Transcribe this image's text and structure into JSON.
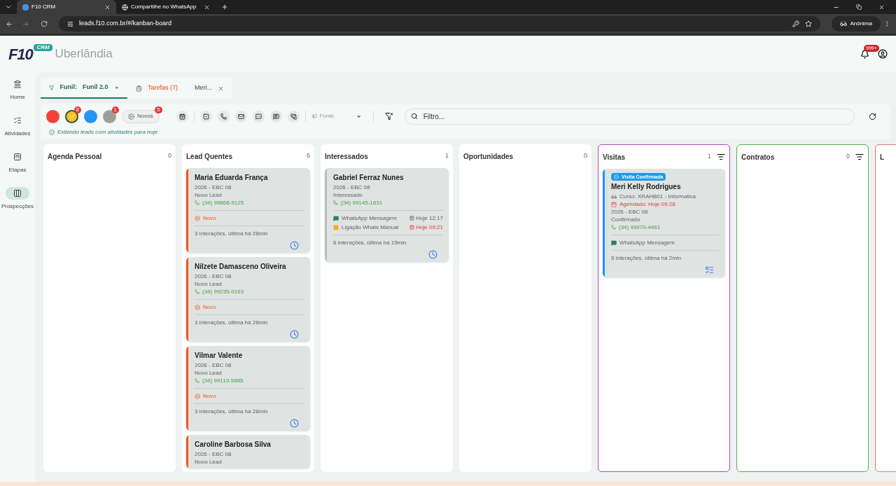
{
  "browser": {
    "tabs": [
      {
        "title": "F10 CRM",
        "selected": true
      },
      {
        "title": "Compartilhe no WhatsApp",
        "selected": false
      }
    ],
    "url": "leads.f10.com.br/#/kanban-board",
    "profile": "Anônima"
  },
  "header": {
    "logo": "F10",
    "logo_tag": "CRM",
    "city": "Uberlândia",
    "notifications": "999+"
  },
  "sidebar": {
    "items": [
      {
        "label": "Home",
        "selected": false
      },
      {
        "label": "Atividades",
        "selected": false
      },
      {
        "label": "Etapas",
        "selected": false
      },
      {
        "label": "Prospecções",
        "selected": true
      }
    ]
  },
  "tabs": [
    {
      "kind": "funnel",
      "label": "Funil:",
      "value": "Funil 2.0",
      "selected": true
    },
    {
      "kind": "tasks",
      "label": "Tarefas (7)",
      "selected": false
    },
    {
      "kind": "closable",
      "label": "Meri...",
      "selected": false
    }
  ],
  "toolbar": {
    "color_filters": [
      {
        "color": "#f44336",
        "checked": false
      },
      {
        "color": "#fbc02d",
        "checked": true,
        "badge": "8"
      },
      {
        "color": "#2196f3",
        "checked": false
      },
      {
        "color": "#9e9e9e",
        "checked": false,
        "badge": "1"
      }
    ],
    "new_button": {
      "label": "Novos",
      "badge": "5"
    },
    "source": {
      "placeholder": "Fonte"
    },
    "search": {
      "placeholder": "Filtro..."
    },
    "info": "Exibindo leads com atividades para hoje"
  },
  "columns": [
    {
      "title": "Agenda Pessoal",
      "count": "0"
    },
    {
      "title": "Lead Quentes",
      "count": "6",
      "cards": [
        {
          "kind": "pending",
          "name": "Maria Eduarda França",
          "group": "2026 - EBC 08",
          "stage": "Novo Lead",
          "phone": "(34) 99868-9125",
          "status": "Novo",
          "interactions": "3 interações, última há 28min",
          "color": "#f4511e"
        },
        {
          "kind": "pending",
          "name": "Nilzete Damasceno Oliveira",
          "group": "2026 - EBC 08",
          "stage": "Novo Lead",
          "phone": "(34) 99235-0163",
          "status": "Novo",
          "interactions": "3 interações, última há 28min",
          "color": "#f4511e"
        },
        {
          "kind": "pending",
          "name": "Vilmar Valente",
          "group": "2026 - EBC 08",
          "stage": "Novo Lead",
          "phone": "(34) 99119-5885",
          "status": "Novo",
          "interactions": "3 interações, última há 28min",
          "color": "#f4511e"
        },
        {
          "name": "Caroline Barbosa Silva",
          "group": "2026 - EBC 08",
          "stage": "Novo Lead",
          "color": "#f4511e"
        }
      ]
    },
    {
      "title": "Interessados",
      "count": "1",
      "cards": [
        {
          "kind": "pending",
          "name": "Gabriel Ferraz Nunes",
          "group": "2026 - EBC 08",
          "stage": "Interessado",
          "phone": "(34) 99145-1831",
          "activities": [
            {
              "kind": "whatsapp",
              "label": "WhatsApp Mensagem",
              "time": "Hoje 12:17",
              "overdue": false
            },
            {
              "kind": "call",
              "label": "Ligação Whats Manual",
              "time": "Hoje 09:21",
              "overdue": true
            }
          ],
          "interactions": "6 interações, última há 15min",
          "color": "#bdbdbd"
        }
      ]
    },
    {
      "title": "Oportunidades",
      "count": "0"
    },
    {
      "title": "Visitas",
      "count": "1",
      "color": "#ab47bc",
      "filter": true,
      "cards": [
        {
          "kind": "confirmed",
          "badge": "Visita Confirmada",
          "name": "Meri Kelly Rodrigues",
          "course": "Curso: XRAHB01 - Informatica",
          "scheduled": "Agendado: Hoje 09:28",
          "group": "2026 - EBC 08",
          "stage": "Confirmado",
          "phone": "(34) 99970-4461",
          "activities": [
            {
              "kind": "whatsapp",
              "label": "WhatsApp Mensagem"
            }
          ],
          "interactions": "5 interações, última há 2min",
          "color": "#2196f3"
        }
      ]
    },
    {
      "title": "Contratos",
      "count": "0",
      "color": "#4caf50",
      "filter": true
    },
    {
      "title": "L",
      "color": "#e57373"
    }
  ]
}
